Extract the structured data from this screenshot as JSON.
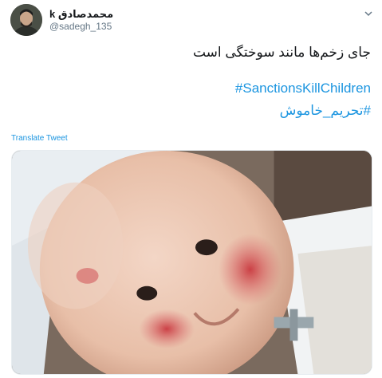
{
  "author": {
    "name": "محمدصادق k",
    "handle": "@sadegh_135"
  },
  "tweet": {
    "text_line": "جای زخم‌ها مانند سوختگی است",
    "hashtag_en": "#SanctionsKillChildren",
    "hashtag_fa": "#تحریم_خاموش"
  },
  "actions": {
    "translate": "Translate Tweet"
  },
  "icons": {
    "menu": "chevron-down-icon"
  },
  "colors": {
    "link": "#1b95e0",
    "handle": "#657786"
  }
}
